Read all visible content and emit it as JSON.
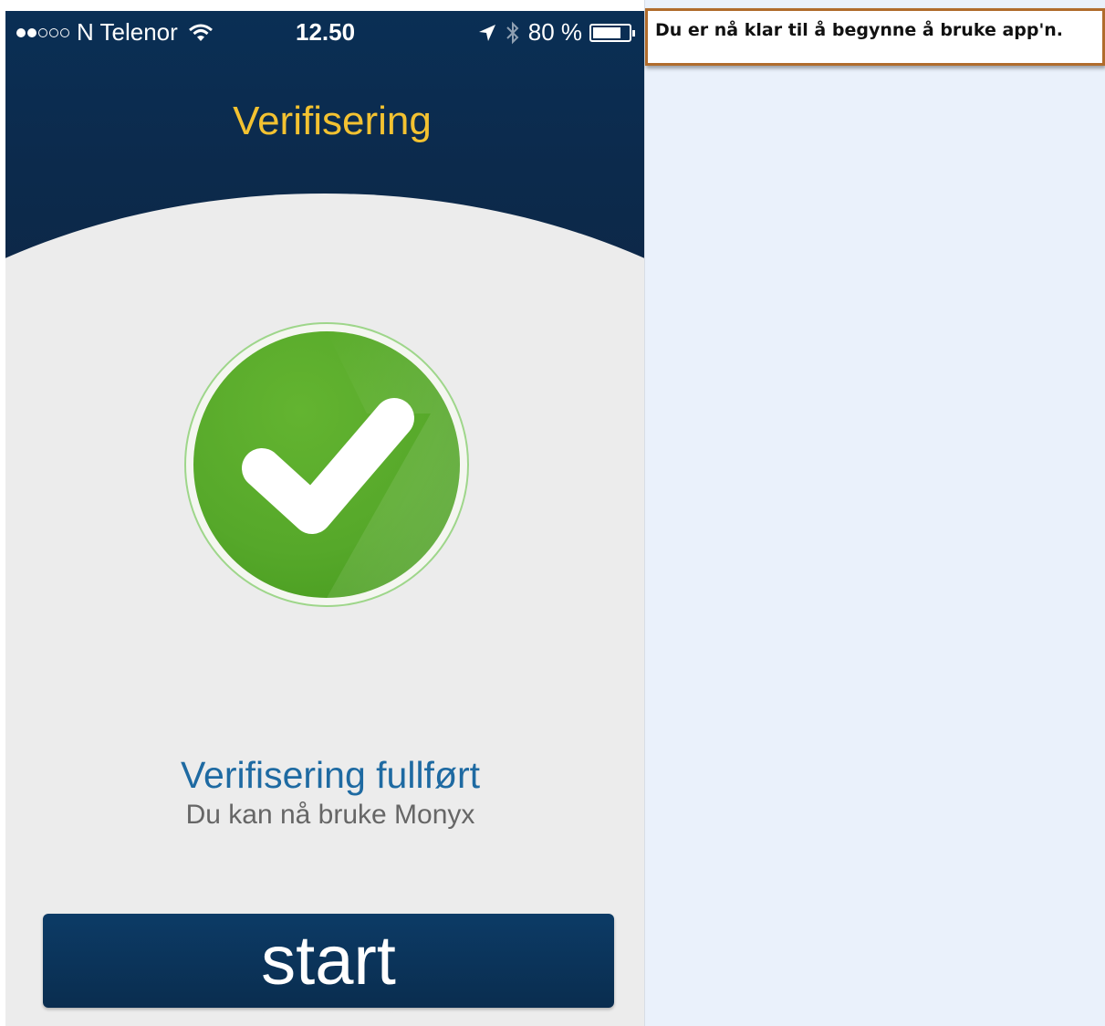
{
  "status_bar": {
    "signal_on": 2,
    "signal_total": 5,
    "carrier": "N Telenor",
    "time": "12.50",
    "battery_text": "80 %",
    "battery_level": 0.8,
    "icons": [
      "wifi-icon",
      "location-arrow-icon",
      "bluetooth-icon",
      "battery-icon"
    ]
  },
  "header": {
    "title": "Verifisering",
    "title_color": "#f3c231",
    "background_color": "#0c2a4c"
  },
  "status": {
    "icon": "checkmark-icon",
    "icon_color": "#5aac2c",
    "title": "Verifisering fullført",
    "subtitle": "Du kan nå bruke Monyx"
  },
  "start_button": {
    "label": "start"
  },
  "annotation": {
    "text": "Du er nå klar til å begynne å bruke app'n.",
    "border_color": "#b06c2c"
  }
}
